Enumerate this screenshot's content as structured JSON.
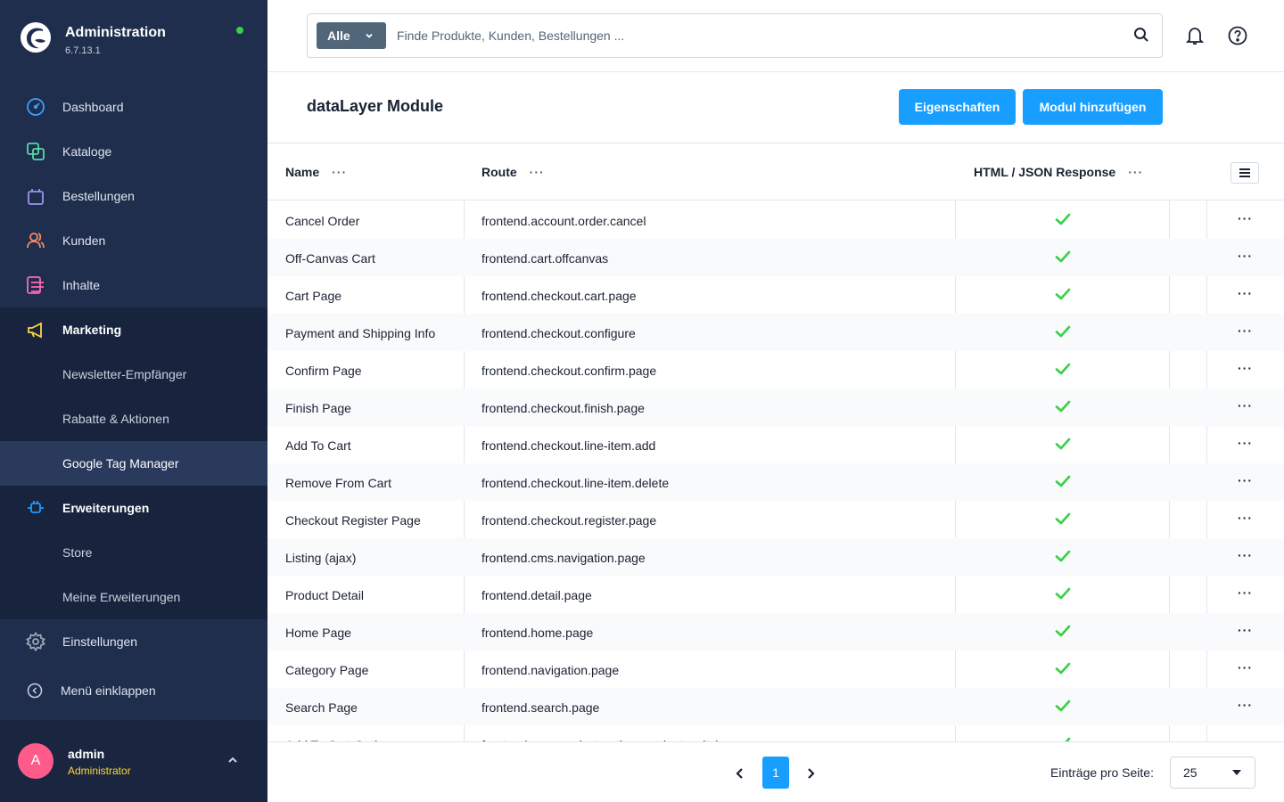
{
  "app": {
    "title": "Administration",
    "version": "6.7.13.1",
    "status_color": "#37d046"
  },
  "sidebar": {
    "items": [
      {
        "label": "Dashboard",
        "icon": "dashboard-icon",
        "color": "#3ba0ff"
      },
      {
        "label": "Kataloge",
        "icon": "catalog-icon",
        "color": "#57d9a3"
      },
      {
        "label": "Bestellungen",
        "icon": "shopping-bag-icon",
        "color": "#a092f0"
      },
      {
        "label": "Kunden",
        "icon": "users-icon",
        "color": "#f88962"
      },
      {
        "label": "Inhalte",
        "icon": "content-icon",
        "color": "#ff68b4"
      },
      {
        "label": "Marketing",
        "icon": "megaphone-icon",
        "color": "#ffd43a"
      },
      {
        "label": "Newsletter-Empfänger"
      },
      {
        "label": "Rabatte & Aktionen"
      },
      {
        "label": "Google Tag Manager"
      },
      {
        "label": "Erweiterungen",
        "icon": "plug-icon",
        "color": "#189eff"
      },
      {
        "label": "Store"
      },
      {
        "label": "Meine Erweiterungen"
      },
      {
        "label": "Einstellungen",
        "icon": "gear-icon",
        "color": "#9aa8b5"
      }
    ],
    "collapse_label": "Menü einklappen",
    "user": {
      "initial": "A",
      "name": "admin",
      "role": "Administrator",
      "avatar_color": "#ff5b8a"
    }
  },
  "topbar": {
    "search_type": "Alle",
    "search_placeholder": "Finde Produkte, Kunden, Bestellungen ..."
  },
  "page": {
    "title": "dataLayer Module",
    "btn_properties": "Eigenschaften",
    "btn_add": "Modul hinzufügen"
  },
  "grid": {
    "columns": [
      "Name",
      "Route",
      "HTML / JSON Response"
    ],
    "column_menu_symbol": "···",
    "row_action_symbol": "···",
    "rows": [
      {
        "name": "Cancel Order",
        "route": "frontend.account.order.cancel",
        "response": true
      },
      {
        "name": "Off-Canvas Cart",
        "route": "frontend.cart.offcanvas",
        "response": true
      },
      {
        "name": "Cart Page",
        "route": "frontend.checkout.cart.page",
        "response": true
      },
      {
        "name": "Payment and Shipping Info",
        "route": "frontend.checkout.configure",
        "response": true
      },
      {
        "name": "Confirm Page",
        "route": "frontend.checkout.confirm.page",
        "response": true
      },
      {
        "name": "Finish Page",
        "route": "frontend.checkout.finish.page",
        "response": true
      },
      {
        "name": "Add To Cart",
        "route": "frontend.checkout.line-item.add",
        "response": true
      },
      {
        "name": "Remove From Cart",
        "route": "frontend.checkout.line-item.delete",
        "response": true
      },
      {
        "name": "Checkout Register Page",
        "route": "frontend.checkout.register.page",
        "response": true
      },
      {
        "name": "Listing (ajax)",
        "route": "frontend.cms.navigation.page",
        "response": true
      },
      {
        "name": "Product Detail",
        "route": "frontend.detail.page",
        "response": true
      },
      {
        "name": "Home Page",
        "route": "frontend.home.page",
        "response": true
      },
      {
        "name": "Category Page",
        "route": "frontend.navigation.page",
        "response": true
      },
      {
        "name": "Search Page",
        "route": "frontend.search.page",
        "response": true
      },
      {
        "name": "Add To Cart Options",
        "route": "frontend.cms.product.options.variant-switch",
        "response": true
      }
    ],
    "check_color": "#37d046"
  },
  "pagination": {
    "current_page": "1",
    "per_page_label": "Einträge pro Seite:",
    "per_page_value": "25"
  }
}
